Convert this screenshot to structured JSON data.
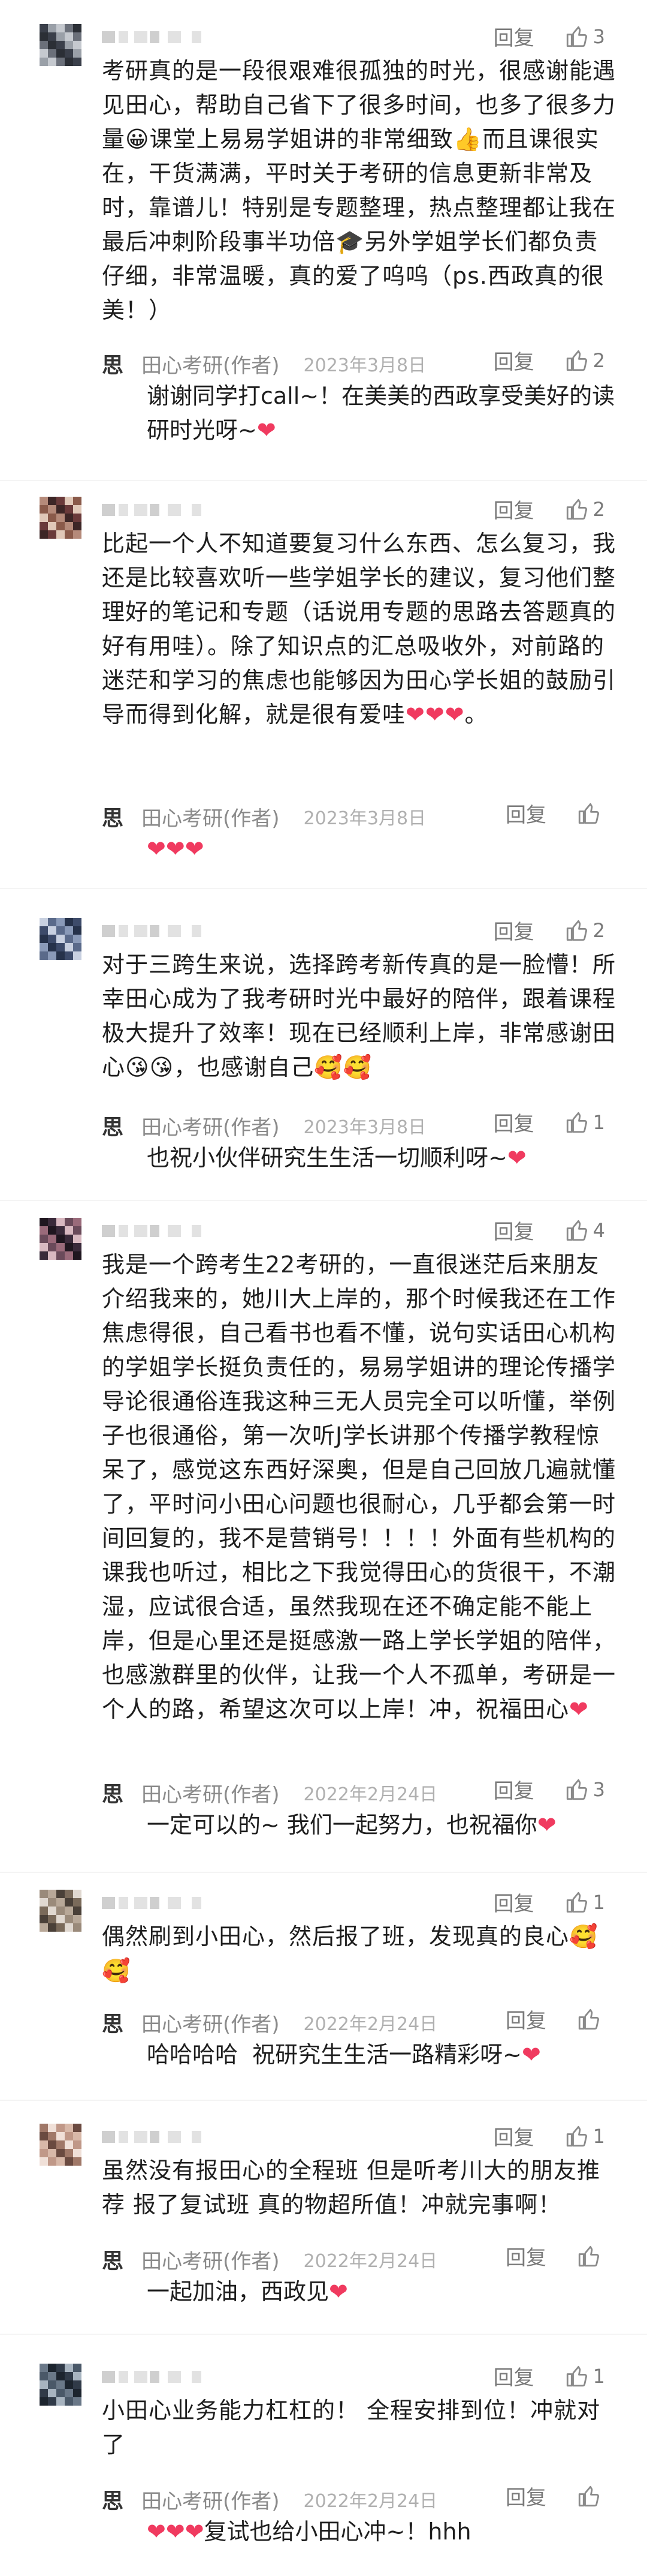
{
  "ui": {
    "reply_label": "回复"
  },
  "author": {
    "name": "田心考研(作者)",
    "logo": "思"
  },
  "comments": [
    {
      "likes": "3",
      "text": "考研真的是一段很艰难很孤独的时光，很感谢能遇见田心，帮助自己省下了很多时间，也多了很多力量😀课堂上易易学姐讲的非常细致👍而且课很实在，干货满满，平时关于考研的信息更新非常及时，靠谱儿！特别是专题整理，热点整理都让我在最后冲刺阶段事半功倍🎓另外学姐学长们都负责仔细，非常温暖，真的爱了呜呜（ps.西政真的很美！）",
      "reply": {
        "date": "2023年3月8日",
        "likes": "2",
        "text": "谢谢同学打call~！在美美的西政享受美好的读研时光呀~❤"
      }
    },
    {
      "likes": "2",
      "text": "比起一个人不知道要复习什么东西、怎么复习，我还是比较喜欢听一些学姐学长的建议，复习他们整理好的笔记和专题（话说用专题的思路去答题真的好有用哇）。除了知识点的汇总吸收外，对前路的迷茫和学习的焦虑也能够因为田心学长姐的鼓励引导而得到化解，就是很有爱哇❤❤❤。",
      "reply": {
        "date": "2023年3月8日",
        "likes": "",
        "text": "❤❤❤"
      }
    },
    {
      "likes": "2",
      "text": "对于三跨生来说，选择跨考新传真的是一脸懵！所幸田心成为了我考研时光中最好的陪伴，跟着课程极大提升了效率！现在已经顺利上岸，非常感谢田心😘😘，也感谢自己🥰🥰",
      "reply": {
        "date": "2023年3月8日",
        "likes": "1",
        "text": "也祝小伙伴研究生生活一切顺利呀~❤"
      }
    },
    {
      "likes": "4",
      "text": "我是一个跨考生22考研的，一直很迷茫后来朋友介绍我来的，她川大上岸的，那个时候我还在工作焦虑得很，自己看书也看不懂，说句实话田心机构的学姐学长挺负责任的，易易学姐讲的理论传播学导论很通俗连我这种三无人员完全可以听懂，举例子也很通俗，第一次听J学长讲那个传播学教程惊呆了，感觉这东西好深奥，但是自己回放几遍就懂了，平时问小田心问题也很耐心，几乎都会第一时间回复的，我不是营销号！！！！外面有些机构的课我也听过，相比之下我觉得田心的货很干，不潮湿，应试很合适，虽然我现在还不确定能不能上岸，但是心里还是挺感激一路上学长学姐的陪伴，也感激群里的伙伴，让我一个人不孤单，考研是一个人的路，希望这次可以上岸！冲，祝福田心❤",
      "reply": {
        "date": "2022年2月24日",
        "likes": "3",
        "text": "一定可以的~ 我们一起努力，也祝福你❤"
      }
    },
    {
      "likes": "1",
      "text": "偶然刷到小田心，然后报了班，发现真的良心🥰🥰",
      "reply": {
        "date": "2022年2月24日",
        "likes": "",
        "text": "哈哈哈哈  祝研究生生活一路精彩呀~❤"
      }
    },
    {
      "likes": "1",
      "text": "虽然没有报田心的全程班 但是听考川大的朋友推荐 报了复试班 真的物超所值！冲就完事啊！",
      "reply": {
        "date": "2022年2月24日",
        "likes": "",
        "text": "一起加油，西政见❤"
      }
    },
    {
      "likes": "1",
      "text": "小田心业务能力杠杠的！ 全程安排到位！冲就对了",
      "reply": {
        "date": "2022年2月24日",
        "likes": "",
        "text": "❤❤❤复试也给小田心冲~！hhh"
      }
    }
  ]
}
